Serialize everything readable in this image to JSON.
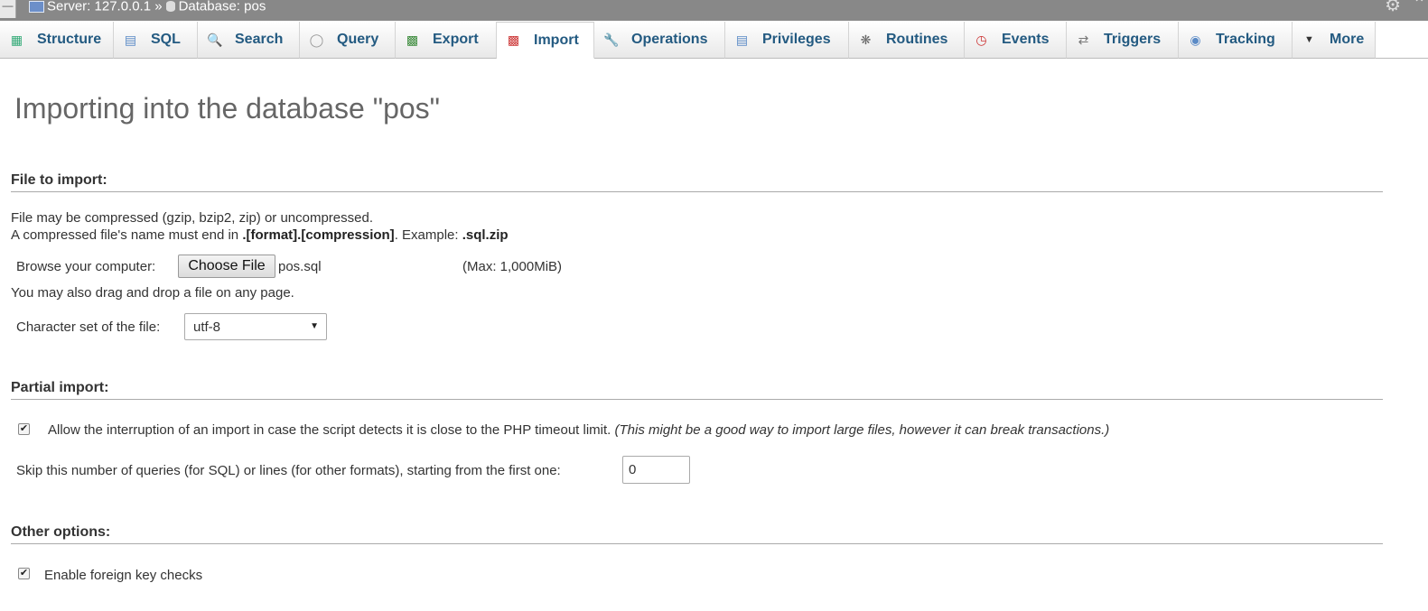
{
  "breadcrumb": {
    "server": "Server: 127.0.0.1",
    "separator": "»",
    "database": "Database: pos"
  },
  "tabs": [
    {
      "label": "Structure",
      "icon": "structure-icon",
      "active": false
    },
    {
      "label": "SQL",
      "icon": "sql-icon",
      "active": false
    },
    {
      "label": "Search",
      "icon": "search-icon",
      "active": false
    },
    {
      "label": "Query",
      "icon": "query-icon",
      "active": false
    },
    {
      "label": "Export",
      "icon": "export-icon",
      "active": false
    },
    {
      "label": "Import",
      "icon": "import-icon",
      "active": true
    },
    {
      "label": "Operations",
      "icon": "wrench-icon",
      "active": false
    },
    {
      "label": "Privileges",
      "icon": "privileges-icon",
      "active": false
    },
    {
      "label": "Routines",
      "icon": "routines-icon",
      "active": false
    },
    {
      "label": "Events",
      "icon": "clock-icon",
      "active": false
    },
    {
      "label": "Triggers",
      "icon": "triggers-icon",
      "active": false
    },
    {
      "label": "Tracking",
      "icon": "eye-icon",
      "active": false
    },
    {
      "label": "More",
      "icon": "chevron-down-icon",
      "active": false
    }
  ],
  "page": {
    "title": "Importing into the database \"pos\""
  },
  "file_to_import": {
    "legend": "File to import:",
    "compress_note": "File may be compressed (gzip, bzip2, zip) or uncompressed.",
    "name_note_prefix": "A compressed file's name must end in ",
    "name_note_format": ".[format].[compression]",
    "name_note_middle": ". Example: ",
    "name_note_example": ".sql.zip",
    "browse_label": "Browse your computer:",
    "choose_file_label": "Choose File",
    "chosen_file": "pos.sql",
    "max_size": "(Max: 1,000MiB)",
    "drag_note": "You may also drag and drop a file on any page.",
    "charset_label": "Character set of the file:",
    "charset_value": "utf-8"
  },
  "partial_import": {
    "legend": "Partial import:",
    "allow_interrupt_checked": true,
    "allow_interrupt_label": "Allow the interruption of an import in case the script detects it is close to the PHP timeout limit.",
    "allow_interrupt_hint": "(This might be a good way to import large files, however it can break transactions.)",
    "skip_label": "Skip this number of queries (for SQL) or lines (for other formats), starting from the first one:",
    "skip_value": "0"
  },
  "other_options": {
    "legend": "Other options:",
    "fk_checks_checked": true,
    "fk_checks_label": "Enable foreign key checks"
  },
  "colors": {
    "tab_text": "#235a81",
    "topbar": "#888888",
    "heading": "#666666"
  }
}
